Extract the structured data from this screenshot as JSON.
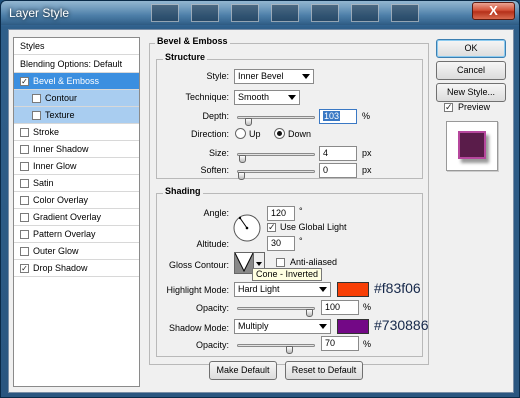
{
  "window": {
    "title": "Layer Style",
    "close_label": "X"
  },
  "styles_list": {
    "header": "Styles",
    "items": [
      {
        "label": "Blending Options: Default",
        "checkbox": false,
        "checked": false,
        "selected": false,
        "sub": false
      },
      {
        "label": "Bevel & Emboss",
        "checkbox": true,
        "checked": true,
        "selected": true,
        "sub": false
      },
      {
        "label": "Contour",
        "checkbox": true,
        "checked": false,
        "selected": false,
        "sub": true
      },
      {
        "label": "Texture",
        "checkbox": true,
        "checked": false,
        "selected": false,
        "sub": true
      },
      {
        "label": "Stroke",
        "checkbox": true,
        "checked": false,
        "selected": false,
        "sub": false
      },
      {
        "label": "Inner Shadow",
        "checkbox": true,
        "checked": false,
        "selected": false,
        "sub": false
      },
      {
        "label": "Inner Glow",
        "checkbox": true,
        "checked": false,
        "selected": false,
        "sub": false
      },
      {
        "label": "Satin",
        "checkbox": true,
        "checked": false,
        "selected": false,
        "sub": false
      },
      {
        "label": "Color Overlay",
        "checkbox": true,
        "checked": false,
        "selected": false,
        "sub": false
      },
      {
        "label": "Gradient Overlay",
        "checkbox": true,
        "checked": false,
        "selected": false,
        "sub": false
      },
      {
        "label": "Pattern Overlay",
        "checkbox": true,
        "checked": false,
        "selected": false,
        "sub": false
      },
      {
        "label": "Outer Glow",
        "checkbox": true,
        "checked": false,
        "selected": false,
        "sub": false
      },
      {
        "label": "Drop Shadow",
        "checkbox": true,
        "checked": true,
        "selected": false,
        "sub": false
      }
    ]
  },
  "bevel": {
    "title": "Bevel & Emboss",
    "structure": {
      "title": "Structure",
      "style_label": "Style:",
      "style_value": "Inner Bevel",
      "technique_label": "Technique:",
      "technique_value": "Smooth",
      "depth_label": "Depth:",
      "depth_value": "103",
      "depth_unit": "%",
      "depth_level": 0.103,
      "direction_label": "Direction:",
      "direction_up": "Up",
      "direction_down": "Down",
      "direction_selected": "Down",
      "size_label": "Size:",
      "size_value": "4",
      "size_unit": "px",
      "size_level": 0.016,
      "soften_label": "Soften:",
      "soften_value": "0",
      "soften_unit": "px",
      "soften_level": 0.0
    },
    "shading": {
      "title": "Shading",
      "angle_label": "Angle:",
      "angle_value": "120",
      "angle_unit": "°",
      "global_light_label": "Use Global Light",
      "global_light_checked": true,
      "altitude_label": "Altitude:",
      "altitude_value": "30",
      "altitude_unit": "°",
      "gloss_label": "Gloss Contour:",
      "anti_aliased_label": "Anti-aliased",
      "anti_aliased_checked": false,
      "tooltip": "Cone - Inverted",
      "highlight_label": "Highlight Mode:",
      "highlight_value": "Hard Light",
      "highlight_color": "#f83f06",
      "highlight_hex": "#f83f06",
      "highlight_opacity_label": "Opacity:",
      "highlight_opacity": "100",
      "highlight_opacity_unit": "%",
      "highlight_opacity_level": 1.0,
      "shadow_label": "Shadow Mode:",
      "shadow_value": "Multiply",
      "shadow_color": "#730886",
      "shadow_hex": "#730886",
      "shadow_opacity_label": "Opacity:",
      "shadow_opacity": "70",
      "shadow_opacity_unit": "%",
      "shadow_opacity_level": 0.7
    },
    "make_default": "Make Default",
    "reset_default": "Reset to Default"
  },
  "buttons": {
    "ok": "OK",
    "cancel": "Cancel",
    "new_style": "New Style...",
    "preview": "Preview",
    "preview_checked": true
  },
  "colors": {
    "selected_item": "#3b8fe0",
    "sub_item": "#a9cdf0",
    "preview_fill": "#5a1c4a"
  }
}
